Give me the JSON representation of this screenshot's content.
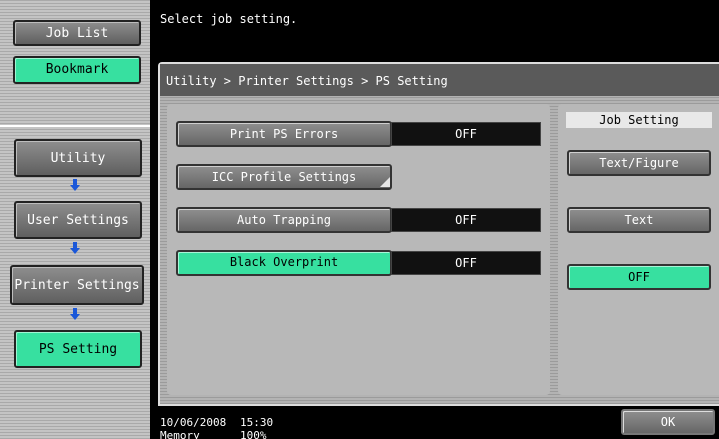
{
  "left_panel": {
    "job_list": "Job List",
    "bookmark": "Bookmark",
    "nav": [
      "Utility",
      "User Settings",
      "Printer Settings",
      "PS Setting"
    ]
  },
  "message": "Select job setting.",
  "breadcrumb": "Utility > Printer Settings > PS Setting",
  "settings": [
    {
      "label": "Print PS Errors",
      "value": "OFF"
    },
    {
      "label": "ICC Profile Settings",
      "value": ""
    },
    {
      "label": "Auto Trapping",
      "value": "OFF"
    },
    {
      "label": "Black Overprint",
      "value": "OFF"
    }
  ],
  "job_setting": {
    "title": "Job Setting",
    "options": [
      "Text/Figure",
      "Text",
      "OFF"
    ],
    "selected": "OFF"
  },
  "footer": {
    "date": "10/06/2008",
    "time": "15:30",
    "memory_label": "Memory",
    "memory_value": "100%"
  },
  "ok_label": "OK",
  "colors": {
    "selected": "#37e0a0",
    "arrow": "#1a57d8"
  }
}
